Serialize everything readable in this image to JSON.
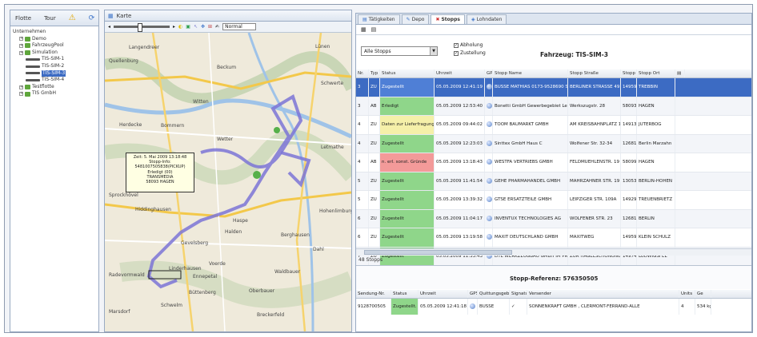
{
  "left": {
    "tab_flotte": "Flotte",
    "tab_tour": "Tour",
    "tree": [
      {
        "label": "Unternehmen",
        "level": 0
      },
      {
        "label": "Demo",
        "level": 1
      },
      {
        "label": "FahrzeugPool",
        "level": 1
      },
      {
        "label": "Simulation",
        "level": 1
      },
      {
        "label": "TIS-SIM-1",
        "level": 2
      },
      {
        "label": "TIS-SIM-2",
        "level": 2
      },
      {
        "label": "TIS-SIM-3",
        "level": 2,
        "selected": true
      },
      {
        "label": "TIS-SIM-4",
        "level": 2
      },
      {
        "label": "Testflotte",
        "level": 1
      },
      {
        "label": "TIS GmbH",
        "level": 1
      }
    ]
  },
  "map": {
    "title": "Karte",
    "select_value": "Normal",
    "popup_lines": [
      "Zeit: 5. Mai 2009 13:18:48",
      "Stopp-Info: 5481007505838(PICKUP)",
      "Erledigt (00)",
      "TRANSMEDIA",
      "58093 HAGEN"
    ],
    "places": [
      {
        "t": "Langendreer"
      },
      {
        "t": "Lünen"
      },
      {
        "t": "Witten"
      },
      {
        "t": "Herdecke"
      },
      {
        "t": "Bommern"
      },
      {
        "t": "Wetter"
      },
      {
        "t": "Sprockhövel"
      },
      {
        "t": "Hiddinghausen"
      },
      {
        "t": "Gevelsberg"
      },
      {
        "t": "Ennepetal"
      },
      {
        "t": "Schwelm"
      },
      {
        "t": "Breckerfeld"
      },
      {
        "t": "Oberbauer"
      },
      {
        "t": "Halden"
      },
      {
        "t": "Letmathe"
      },
      {
        "t": "Hohenlimburg"
      },
      {
        "t": "Dahl"
      },
      {
        "t": "Waldbauer"
      },
      {
        "t": "Haspe"
      },
      {
        "t": "Voerde"
      },
      {
        "t": "Linderhausen"
      },
      {
        "t": "Büttenberg"
      },
      {
        "t": "Quellenburg"
      },
      {
        "t": "Berghausen"
      },
      {
        "t": "Schwerte"
      },
      {
        "t": "Beckum"
      },
      {
        "t": "Marsdorf"
      },
      {
        "t": "Radevormwald"
      }
    ]
  },
  "tabs": [
    "Tätigkeiten",
    "Depo",
    "Stopps",
    "Lohndaten"
  ],
  "active_tab": "Stopps",
  "filter": {
    "combo": "Alle Stopps",
    "abholung": "Abholung",
    "zustellung": "Zustellung",
    "fahrzeug": "Fahrzeug: TIS-SIM-3"
  },
  "grid": {
    "headers": [
      "Nr.",
      "Typ",
      "Status",
      "Uhrzeit",
      "GPS",
      "Stopp Name",
      "Stopp Straße",
      "Stopp PL",
      "Stopp Ort"
    ],
    "rows": [
      {
        "nr": "3",
        "typ": "ZU",
        "status": "Zugestellt",
        "st": "blue",
        "zeit": "05.05.2009 12:41:19",
        "name": "BUSSE MATHIAS 0173-9528690 S",
        "strasse": "BERLINER STRASSE 49",
        "plz": "14959",
        "ort": "TREBBIN",
        "sel": true
      },
      {
        "nr": "3",
        "typ": "AB",
        "status": "Erledigt",
        "st": "green",
        "zeit": "05.05.2009 12:53:40",
        "name": "Bonetti GmbH Gewerbegebiet Lenn",
        "strasse": "Werkszugstr. 28",
        "plz": "58093",
        "ort": "HAGEN"
      },
      {
        "nr": "4",
        "typ": "ZU",
        "status": "Daten zur Lieferfragung",
        "st": "yellow",
        "zeit": "05.05.2009 09:44:02",
        "name": "TOOM BAUMARKT GMBH",
        "strasse": "AM KREISBAHNPLATZ 1",
        "plz": "14913",
        "ort": "JUTERBOG"
      },
      {
        "nr": "4",
        "typ": "ZU",
        "status": "Zugestellt",
        "st": "green",
        "zeit": "05.05.2009 12:23:03",
        "name": "Sinttex GmbH Haus C",
        "strasse": "Wolfener Str. 32-34",
        "plz": "12681",
        "ort": "Berlin Marzahn"
      },
      {
        "nr": "4",
        "typ": "AB",
        "status": "n. erl. sonst. Gründe",
        "st": "red",
        "zeit": "05.05.2009 13:18:43",
        "name": "WESTFA VERTRIEBS GMBH",
        "strasse": "FELDMUEHLENSTR. 19",
        "plz": "58099",
        "ort": "HAGEN"
      },
      {
        "nr": "5",
        "typ": "ZU",
        "status": "Zugestellt",
        "st": "green",
        "zeit": "05.05.2009 11:41:54",
        "name": "GEHE PHARMAHANDEL GMBH",
        "strasse": "MAHRZAHNER STR. 19",
        "plz": "13053",
        "ort": "BERLIN-HOHEN"
      },
      {
        "nr": "5",
        "typ": "ZU",
        "status": "Zugestellt",
        "st": "green",
        "zeit": "05.05.2009 13:39:32",
        "name": "GTSE ERSATZTEILE GMBH",
        "strasse": "LEIPZIGER STR. 109A",
        "plz": "14929",
        "ort": "TREUENBRIETZ"
      },
      {
        "nr": "6",
        "typ": "ZU",
        "status": "Zugestellt",
        "st": "green",
        "zeit": "05.05.2009 11:04:17",
        "name": "INVENTUX TECHNOLOGIES AG",
        "strasse": "WOLFENER STR. 23",
        "plz": "12681",
        "ort": "BERLIN"
      },
      {
        "nr": "6",
        "typ": "ZU",
        "status": "Zugestellt",
        "st": "green",
        "zeit": "05.05.2009 13:19:58",
        "name": "MAXIT DEUTSCHLAND GMBH",
        "strasse": "MAXITWEG",
        "plz": "14959",
        "ort": "KLEIN SCHULZ"
      },
      {
        "nr": "7",
        "typ": "ZU",
        "status": "Zugestellt",
        "st": "green",
        "zeit": "05.05.2009 11:33:43",
        "name": "DTL WERKZEUGBAU GMBH IM PRE",
        "strasse": "ZUR HAGELSCHONUNG",
        "plz": "14974",
        "ort": "LUDWIGSFEL"
      }
    ]
  },
  "count": "48 Stopps",
  "ref_title": "Stopp-Referenz: 576350505",
  "grid2": {
    "headers": [
      "Sendung-Nr.",
      "Status",
      "Uhrzeit",
      "GPS",
      "Quittungsgeber",
      "Signatur",
      "Versender",
      "Units",
      "Ge"
    ],
    "row": {
      "nr": "9128700505",
      "status": "Zugestellt.",
      "zeit": "05.05.2009 12:41:18",
      "quitt": "BUSSE",
      "vers": "SONNENKRAFT GMBH , CLERMONT-FERRAND-ALLE",
      "units": "4",
      "ge": "534 kg"
    }
  },
  "colors": {
    "select": "#3c6bc3",
    "green": "#8fd68a",
    "red": "#f39a99",
    "yellow": "#f5f0a9",
    "route": "#7b74d6"
  }
}
